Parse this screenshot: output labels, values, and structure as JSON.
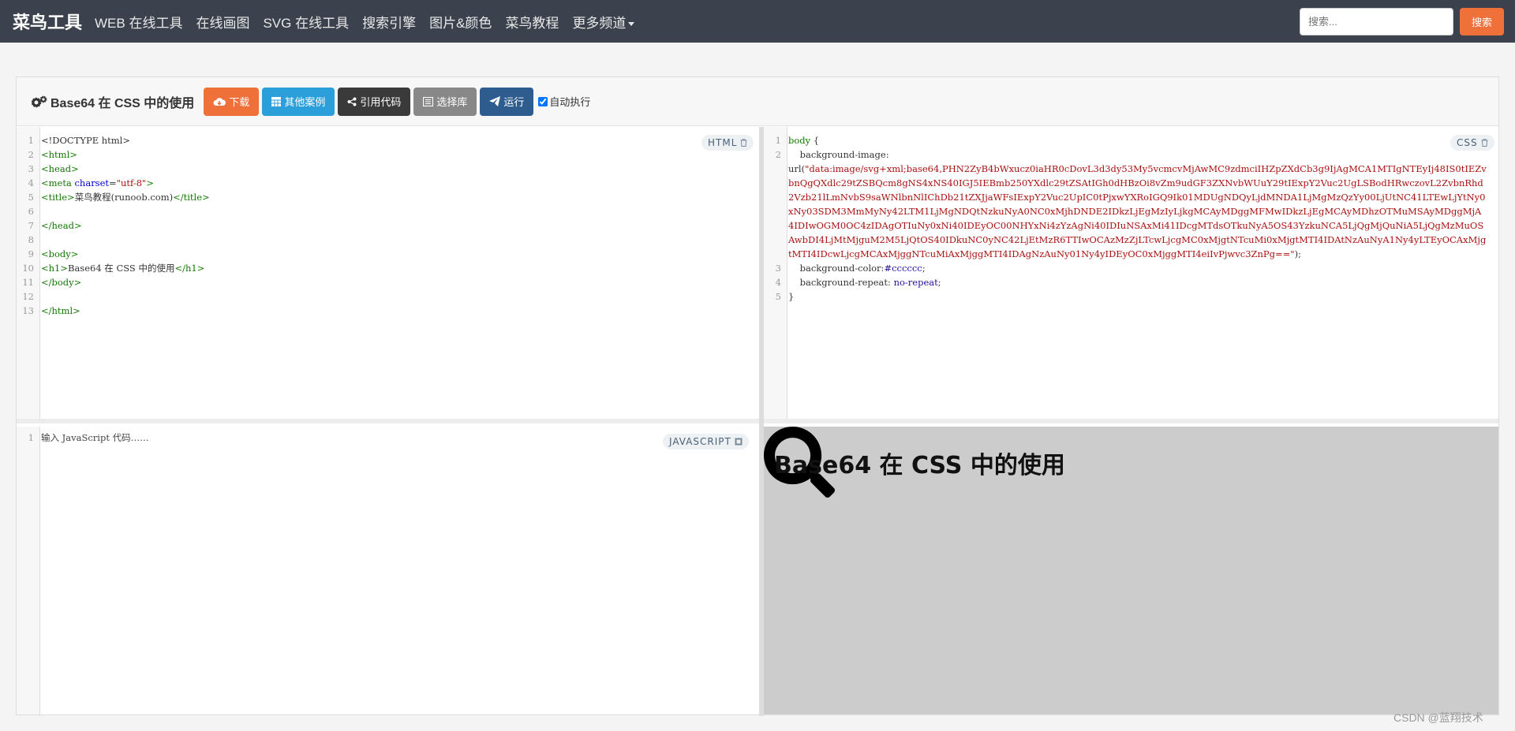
{
  "nav": {
    "brand": "菜鸟工具",
    "links": [
      "WEB 在线工具",
      "在线画图",
      "SVG 在线工具",
      "搜索引擎",
      "图片&颜色",
      "菜鸟教程"
    ],
    "more": "更多频道",
    "search_placeholder": "搜索...",
    "search_button": "搜索"
  },
  "toolbar": {
    "title": "Base64 在 CSS 中的使用",
    "download": "下载",
    "other_cases": "其他案例",
    "cite_code": "引用代码",
    "select_lib": "选择库",
    "run": "运行",
    "auto_run": "自动执行",
    "auto_run_checked": true
  },
  "html_editor": {
    "label": "HTML",
    "line_numbers": [
      "1",
      "2",
      "3",
      "4",
      "5",
      "6",
      "7",
      "8",
      "9",
      "10",
      "11",
      "12",
      "13"
    ],
    "l1": "<!DOCTYPE html>",
    "l2": "<html>",
    "l3": "<head>",
    "l4_tag": "<meta",
    "l4_attr": "charset",
    "l4_eq": "=",
    "l4_val": "\"utf-8\"",
    "l4_close": ">",
    "l5_open": "<title>",
    "l5_text": "菜鸟教程(runoob.com)",
    "l5_close": "</title>",
    "l7": "</head>",
    "l9": "<body>",
    "l10_open": "<h1>",
    "l10_text": "Base64 在 CSS 中的使用",
    "l10_close": "</h1>",
    "l11": "</body>",
    "l13": "</html>"
  },
  "css_editor": {
    "label": "CSS",
    "line_numbers": [
      "1",
      "2",
      "3",
      "4",
      "5"
    ],
    "l1_sel": "body",
    "l1_brace": " {",
    "l2_prop": "    background-image:",
    "l2_url_open": "url(",
    "l2_url_str": "\"data:image/svg+xml;base64,PHN2ZyB4bWxucz0iaHR0cDovL3d3dy53My5vcmcvMjAwMC9zdmciIHZpZXdCb3g9IjAgMCA1MTIgNTEyIj48IS0tIEZvbnQgQXdlc29tZSBQcm8gNS4xNS40IGJ5IEBmb250YXdlc29tZSAtIGh0dHBzOi8vZm9udGF3ZXNvbWUuY29tIExpY2Vuc2UgLSBodHRwczovL2ZvbnRhd2Vzb21lLmNvbS9saWNlbnNlIChDb21tZXJjaWFsIExpY2Vuc2UpIC0tPjxwYXRoIGQ9Ik01MDUgNDQyLjdMNDA1LjMgMzQzYy00LjUtNC41LTEwLjYtNy0xNy03SDM3MmMyNy42LTM1LjMgNDQtNzkuNyA0NC0xMjhDNDE2IDkzLjEgMzIyLjkgMCAyMDggMFMwIDkzLjEgMCAyMDhzOTMuMSAyMDggMjA4IDIwOGM0OC4zIDAgOTIuNy0xNi40IDEyOC00NHYxNi4zYzAgNi40IDIuNSAxMi41IDcgMTdsOTkuNyA5OS43YzkuNCA5LjQgMjQuNiA5LjQgMzMuOSAwbDI4LjMtMjguM2M5LjQtOS40IDkuNC0yNC42LjEtMzR6TTIwOCAzMzZjLTcwLjcgMC0xMjgtNTcuMi0xMjgtMTI4IDAtNzAuNyA1Ny4yLTEyOCAxMjgtMTI4IDcwLjcgMCAxMjggNTcuMiAxMjggMTI4IDAgNzAuNy01Ny4yIDEyOC0xMjggMTI4eiIvPjwvc3ZnPg==\"",
    "l2_url_close": ");",
    "l3_prop": "    background-color:",
    "l3_val": "#cccccc",
    "l3_end": ";",
    "l4_prop": "    background-repeat: ",
    "l4_val": "no-repeat",
    "l4_end": ";",
    "l5": "}"
  },
  "js_editor": {
    "label": "JAVASCRIPT",
    "line_numbers": [
      "1"
    ],
    "placeholder": "输入 JavaScript 代码……"
  },
  "result": {
    "heading": "Base64 在 CSS 中的使用",
    "background_color": "#cccccc"
  },
  "watermark": "CSDN @蓝翔技术"
}
